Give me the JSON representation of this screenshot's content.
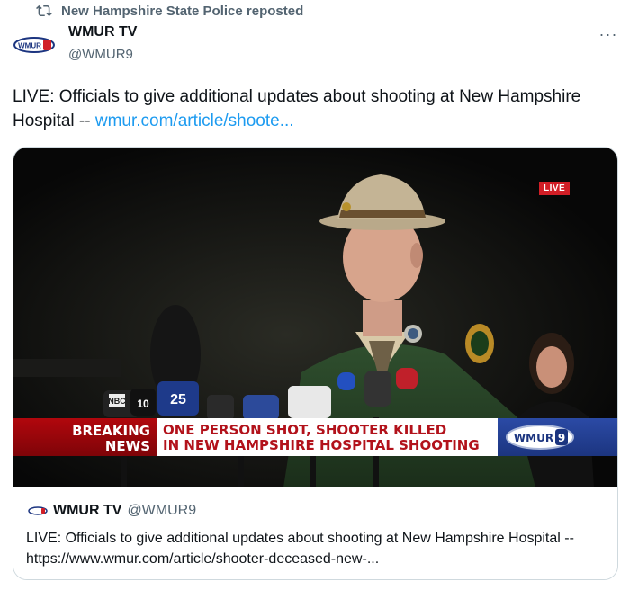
{
  "repost": {
    "icon": "repost-icon",
    "text": "New Hampshire State Police reposted"
  },
  "author": {
    "name": "WMUR TV",
    "handle": "@WMUR9",
    "avatar_icon": "wmur-logo-icon",
    "avatar_text": "WMUR"
  },
  "more_menu": {
    "icon": "more-horizontal-icon",
    "label": "···"
  },
  "tweet": {
    "text": "LIVE: Officials to give additional updates about shooting at New Hampshire Hospital --",
    "link": "wmur.com/article/shoote..."
  },
  "media": {
    "live_badge": "LIVE",
    "breaking_1": "BREAKING",
    "breaking_2": "NEWS",
    "headline_1": "ONE PERSON SHOT, SHOOTER KILLED",
    "headline_2": "IN NEW HAMPSHIRE HOSPITAL SHOOTING",
    "channel_logo": "WMUR",
    "mic_labels": [
      "NBC",
      "10",
      "25"
    ]
  },
  "quoted": {
    "name": "WMUR TV",
    "handle": "@WMUR9",
    "text": "LIVE: Officials to give additional updates about shooting at New Hampshire Hospital -- https://www.wmur.com/article/shooter-deceased-new-..."
  },
  "colors": {
    "accent": "#1d9bf0",
    "breaking_red": "#b1070d",
    "wmur_blue": "#2b4aa5"
  }
}
